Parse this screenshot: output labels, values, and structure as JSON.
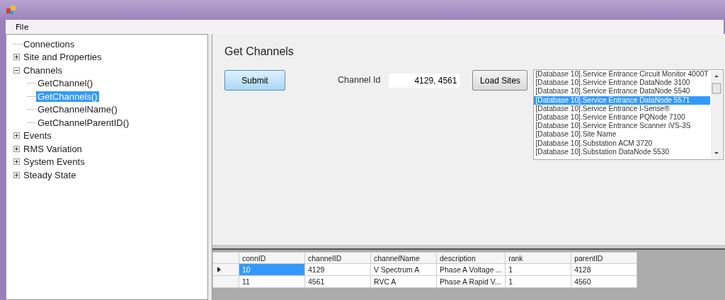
{
  "menu": [
    "File"
  ],
  "tree": [
    {
      "label": "Connections",
      "selected": false
    },
    {
      "label": "Site and Properties",
      "expanded": false,
      "selected": false
    },
    {
      "label": "Channels",
      "expanded": true,
      "selected": false,
      "children": [
        {
          "label": "GetChannel()",
          "selected": false
        },
        {
          "label": "GetChannels()",
          "selected": true
        },
        {
          "label": "GetChannelName()",
          "selected": false
        },
        {
          "label": "GetChannelParentID()",
          "selected": false
        }
      ]
    },
    {
      "label": "Events",
      "expanded": false,
      "selected": false
    },
    {
      "label": "RMS Variation",
      "expanded": false,
      "selected": false
    },
    {
      "label": "System Events",
      "expanded": false,
      "selected": false
    },
    {
      "label": "Steady State",
      "expanded": false,
      "selected": false
    }
  ],
  "heading": "Get Channels",
  "submit_button": "Submit",
  "channel_id": {
    "label": "Channel Id",
    "value": "4129, 4561"
  },
  "load_sites_button": "Load Sites",
  "sites": [
    {
      "label": "[Database 10].Service Entrance Circuit Monitor 4000T",
      "selected": false
    },
    {
      "label": "[Database 10].Service Entrance DataNode 3100",
      "selected": false
    },
    {
      "label": "[Database 10].Service Entrance DataNode 5540",
      "selected": false
    },
    {
      "label": "[Database 10].Service Entrance DataNode 5571",
      "selected": true
    },
    {
      "label": "[Database 10].Service Entrance I-Sense®",
      "selected": false
    },
    {
      "label": "[Database 10].Service Entrance PQNode 7100",
      "selected": false
    },
    {
      "label": "[Database 10].Service Entrance Scanner iVS-3S",
      "selected": false
    },
    {
      "label": "[Database 10].Site Name",
      "selected": false
    },
    {
      "label": "[Database 10].Substation ACM 3720",
      "selected": false
    },
    {
      "label": "[Database 10].Substation DataNode 5530",
      "selected": false
    }
  ],
  "table": {
    "columns": [
      "connID",
      "channelID",
      "channelName",
      "description",
      "rank",
      "parentID"
    ],
    "rows": [
      {
        "selected": true,
        "cells": [
          "10",
          "4129",
          "V Spectrum A",
          "Phase A Voltage ...",
          "1",
          "4128"
        ]
      },
      {
        "selected": false,
        "cells": [
          "11",
          "4561",
          "RVC A",
          "Phase A Rapid V...",
          "1",
          "4560"
        ]
      }
    ]
  }
}
